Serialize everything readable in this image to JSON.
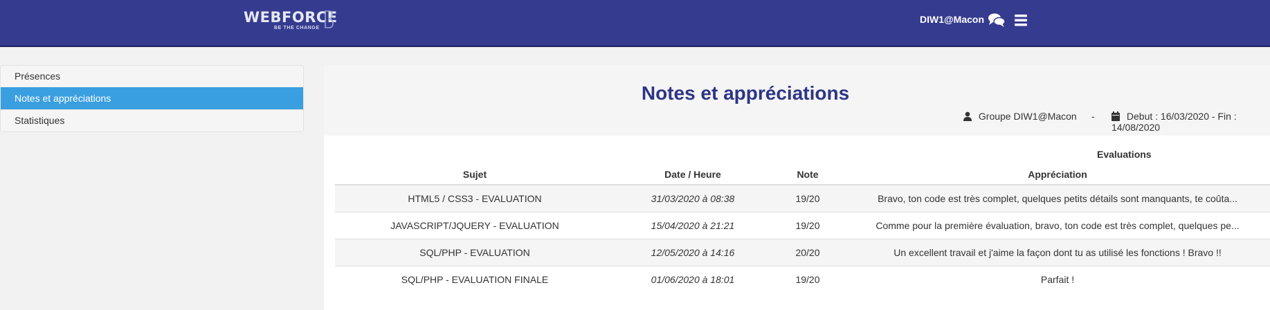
{
  "header": {
    "logo_text": "WEBFORCE",
    "logo_tagline": "BE THE CHANGE",
    "user_label": "DIW1@Macon",
    "icons": [
      "chat-icon",
      "menu-icon"
    ],
    "background_color": "#353b8f"
  },
  "sidebar": {
    "items": [
      {
        "label": "Présences",
        "active": false
      },
      {
        "label": "Notes et appréciations",
        "active": true
      },
      {
        "label": "Statistiques",
        "active": false
      }
    ],
    "active_color": "#3a9fe0"
  },
  "main": {
    "title": "Notes et appréciations",
    "group_label": "Groupe DIW1@Macon",
    "separator": "-",
    "dates_label": "Debut : 16/03/2020 - Fin : 14/08/2020",
    "title_color": "#2e3586"
  },
  "table": {
    "caption": "Evaluations",
    "columns": [
      "Sujet",
      "Date / Heure",
      "Note",
      "Appréciation"
    ],
    "rows": [
      {
        "sujet": "HTML5 / CSS3 - EVALUATION",
        "date": "31/03/2020 à 08:38",
        "note": "19/20",
        "appreciation": "Bravo, ton code est très complet, quelques petits détails sont manquants, te coûta..."
      },
      {
        "sujet": "JAVASCRIPT/JQUERY - EVALUATION",
        "date": "15/04/2020 à 21:21",
        "note": "19/20",
        "appreciation": "Comme pour la première évaluation, bravo, ton code est très complet, quelques pe..."
      },
      {
        "sujet": "SQL/PHP - EVALUATION",
        "date": "12/05/2020 à 14:16",
        "note": "20/20",
        "appreciation": "Un excellent travail et j'aime la façon dont tu as utilisé les fonctions ! Bravo !!"
      },
      {
        "sujet": "SQL/PHP - EVALUATION FINALE",
        "date": "01/06/2020 à 18:01",
        "note": "19/20",
        "appreciation": "Parfait !"
      }
    ]
  }
}
